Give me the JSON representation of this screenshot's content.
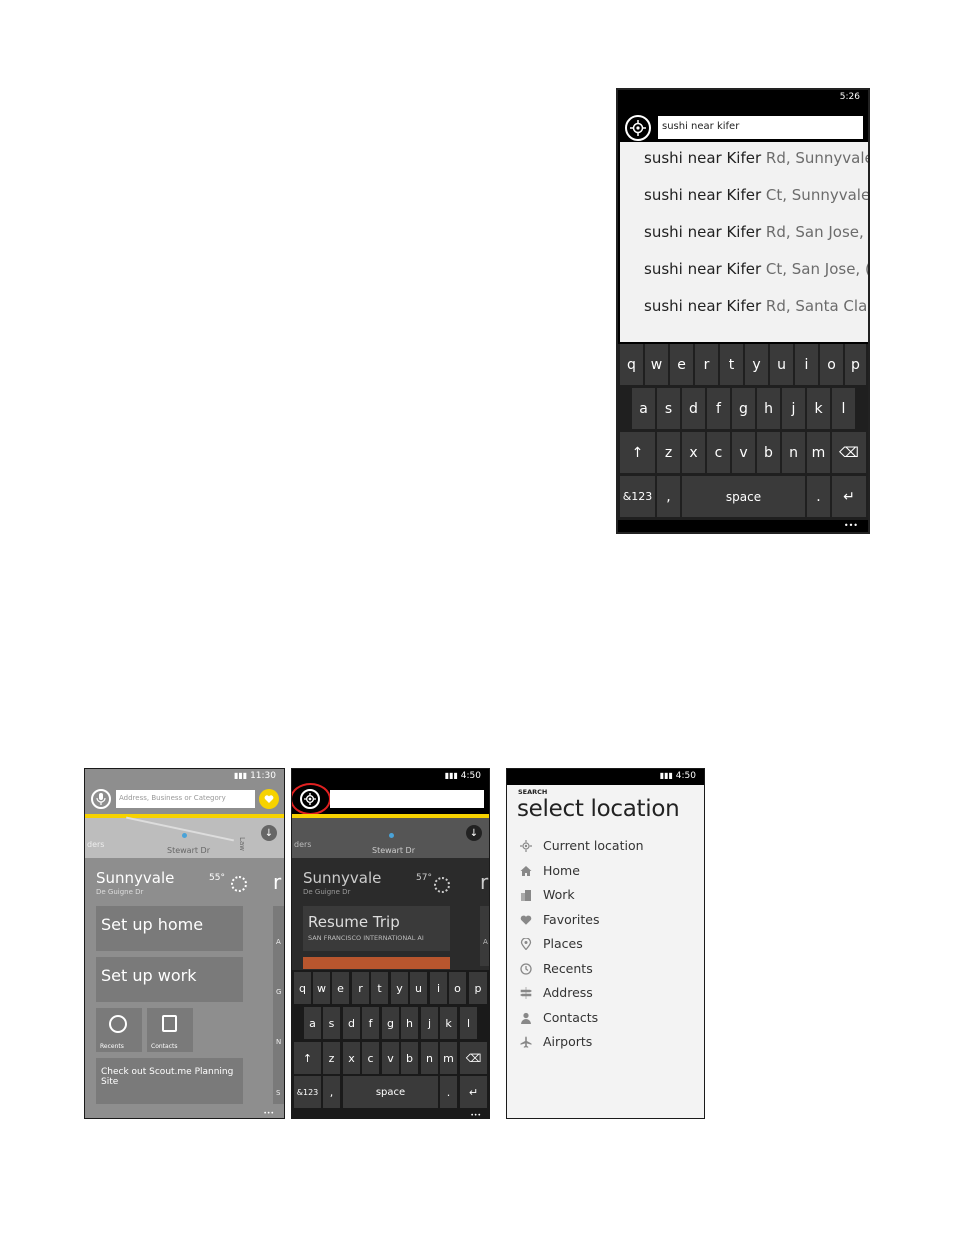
{
  "phone1": {
    "time": "5:26",
    "search_value": "sushi near kifer",
    "suggestions": [
      {
        "bold": "sushi near Kifer",
        "rest": " Rd, Sunnyvale"
      },
      {
        "bold": "sushi near Kifer",
        "rest": " Ct, Sunnyvale"
      },
      {
        "bold": "sushi near Kifer",
        "rest": " Rd, San Jose,"
      },
      {
        "bold": "sushi near Kifer",
        "rest": " Ct, San Jose, ("
      },
      {
        "bold": "sushi near Kifer",
        "rest": " Rd, Santa Clar"
      }
    ],
    "keyboard": {
      "row1": [
        "q",
        "w",
        "e",
        "r",
        "t",
        "y",
        "u",
        "i",
        "o",
        "p"
      ],
      "row2": [
        "a",
        "s",
        "d",
        "f",
        "g",
        "h",
        "j",
        "k",
        "l"
      ],
      "row3": [
        "z",
        "x",
        "c",
        "v",
        "b",
        "n",
        "m"
      ],
      "shift": "↑",
      "backspace": "⌫",
      "symbols": "&123",
      "comma": ",",
      "space": "space",
      "period": ".",
      "enter": "↵"
    },
    "more": "•••"
  },
  "phone2": {
    "time": "11:30",
    "placeholder": "Address, Business or Category",
    "map_label1": "ders",
    "map_label2": "Stewart Dr",
    "map_label3": "Law",
    "city": "Sunnyvale",
    "street": "De Guigne Dr",
    "temp": "55°",
    "tiles": {
      "home": "Set up home",
      "work": "Set up work",
      "recents": "Recents",
      "contacts": "Contacts",
      "scout": "Check out Scout.me Planning Site"
    },
    "side_letters": [
      "A",
      "G",
      "N",
      "S"
    ],
    "more": "•••"
  },
  "phone3": {
    "time": "4:50",
    "map_label1": "ders",
    "map_label2": "Stewart Dr",
    "city": "Sunnyvale",
    "street": "De Guigne Dr",
    "temp": "57°",
    "resume_title": "Resume Trip",
    "resume_sub": "SAN FRANCISCO INTERNATIONAL AI",
    "side_letters": [
      "A"
    ],
    "keyboard": {
      "row1": [
        "q",
        "w",
        "e",
        "r",
        "t",
        "y",
        "u",
        "i",
        "o",
        "p"
      ],
      "row2": [
        "a",
        "s",
        "d",
        "f",
        "g",
        "h",
        "j",
        "k",
        "l"
      ],
      "row3": [
        "z",
        "x",
        "c",
        "v",
        "b",
        "n",
        "m"
      ],
      "shift": "↑",
      "backspace": "⌫",
      "symbols": "&123",
      "comma": ",",
      "space": "space",
      "period": ".",
      "enter": "↵"
    },
    "more": "•••"
  },
  "phone4": {
    "time": "4:50",
    "overline": "SEARCH",
    "title": "select location",
    "items": [
      "Current location",
      "Home",
      "Work",
      "Favorites",
      "Places",
      "Recents",
      "Address",
      "Contacts",
      "Airports"
    ]
  },
  "colors": {
    "accent_yellow": "#f7d200",
    "annotation_red": "#e02020"
  }
}
